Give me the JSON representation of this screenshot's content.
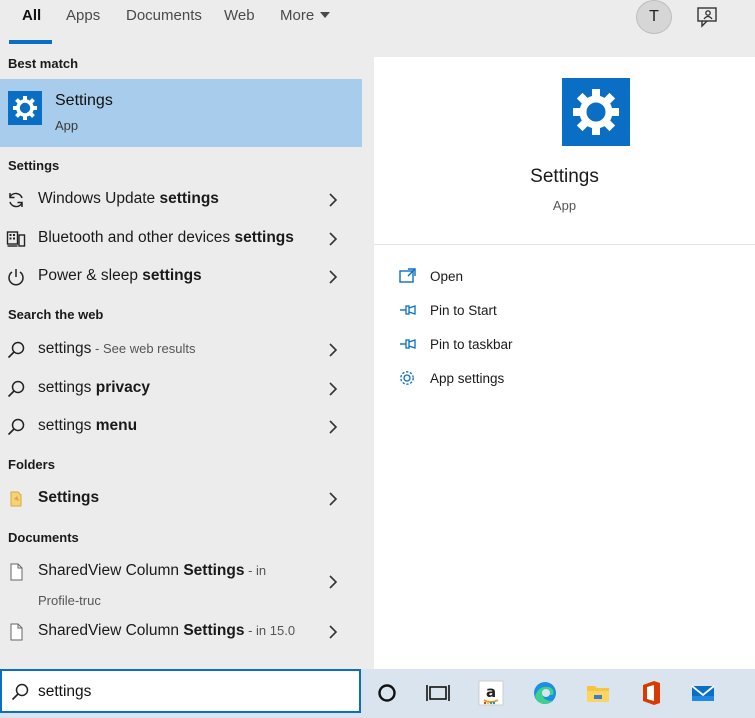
{
  "tabs": [
    {
      "label": "All"
    },
    {
      "label": "Apps"
    },
    {
      "label": "Documents"
    },
    {
      "label": "Web"
    },
    {
      "label": "More"
    }
  ],
  "user": {
    "initial": "T"
  },
  "sections": {
    "best_match": "Best match",
    "settings": "Settings",
    "search_web": "Search the web",
    "folders": "Folders",
    "documents": "Documents"
  },
  "best_match": {
    "title": "Settings",
    "subtitle": "App"
  },
  "settings_results": [
    {
      "pre": "Windows Update ",
      "bold": "settings"
    },
    {
      "pre": "Bluetooth and other devices ",
      "bold": "settings"
    },
    {
      "pre": "Power & sleep ",
      "bold": "settings"
    }
  ],
  "web_results": [
    {
      "pre": "settings",
      "bold": "",
      "hint": " - See web results"
    },
    {
      "pre": "settings ",
      "bold": "privacy",
      "hint": ""
    },
    {
      "pre": "settings ",
      "bold": "menu",
      "hint": ""
    }
  ],
  "folder_results": [
    {
      "label": "Settings"
    }
  ],
  "document_results": [
    {
      "pre": "SharedView Column ",
      "bold": "Settings",
      "hint": " - in",
      "line2": "Profile-truc"
    },
    {
      "pre": "SharedView Column ",
      "bold": "Settings",
      "hint": " - in 15.0",
      "line2": ""
    }
  ],
  "preview": {
    "title": "Settings",
    "subtitle": "App",
    "actions": [
      {
        "label": "Open",
        "icon": "open-icon"
      },
      {
        "label": "Pin to Start",
        "icon": "pin-icon"
      },
      {
        "label": "Pin to taskbar",
        "icon": "pin-icon"
      },
      {
        "label": "App settings",
        "icon": "gear-icon"
      }
    ]
  },
  "search": {
    "value": "settings"
  },
  "colors": {
    "accent": "#0a6fc4",
    "selected": "#a8cdec",
    "office": "#d83b01"
  }
}
